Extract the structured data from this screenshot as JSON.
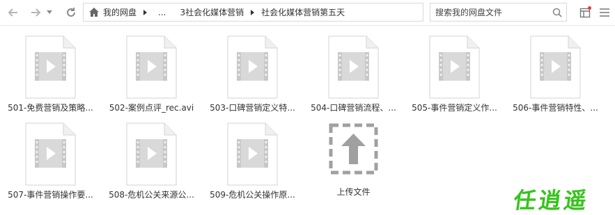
{
  "toolbar": {
    "breadcrumb": {
      "root": "我的网盘",
      "ellipsis": "...",
      "folder": "3社会化媒体营销",
      "current": "社会化媒体营销第五天"
    },
    "search": {
      "placeholder": "搜索我的网盘文件"
    }
  },
  "files": [
    {
      "label": "501-免费营销及策略...",
      "type": "video"
    },
    {
      "label": "502-案例点评_rec.avi",
      "type": "video"
    },
    {
      "label": "503-口碑营销定义特...",
      "type": "video"
    },
    {
      "label": "504-口碑营销流程、...",
      "type": "video"
    },
    {
      "label": "505-事件营销定义作...",
      "type": "video"
    },
    {
      "label": "506-事件营销特性、...",
      "type": "video"
    },
    {
      "label": "507-事件营销操作要...",
      "type": "video"
    },
    {
      "label": "508-危机公关来源公...",
      "type": "video"
    },
    {
      "label": "509-危机公关操作原...",
      "type": "video"
    }
  ],
  "upload": {
    "label": "上传文件"
  },
  "watermark": {
    "text": "任逍遥"
  },
  "colors": {
    "accent": "#35c41b",
    "badge": "#e53935"
  }
}
